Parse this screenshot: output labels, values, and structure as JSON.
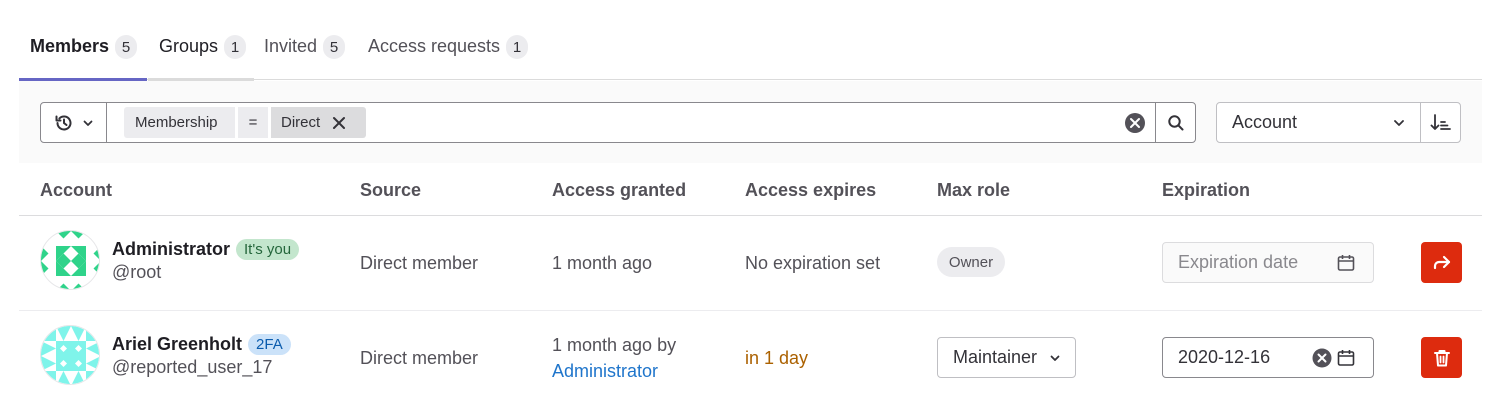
{
  "tabs": [
    {
      "label": "Members",
      "count": "5",
      "active": true
    },
    {
      "label": "Groups",
      "count": "1",
      "active": false
    },
    {
      "label": "Invited",
      "count": "5",
      "active": false
    },
    {
      "label": "Access requests",
      "count": "1",
      "active": false
    }
  ],
  "filter": {
    "token_key": "Membership",
    "token_operator": "=",
    "token_value": "Direct"
  },
  "sort": {
    "selected": "Account"
  },
  "table": {
    "headers": [
      "Account",
      "Source",
      "Access granted",
      "Access expires",
      "Max role",
      "Expiration"
    ],
    "rows": [
      {
        "name": "Administrator",
        "badge": "It's you",
        "username": "@root",
        "source": "Direct member",
        "access_granted": "1 month ago",
        "access_granted_by": "",
        "access_expires": "No expiration set",
        "max_role": "Owner",
        "expiration_value": "",
        "expiration_placeholder": "Expiration date",
        "action": "leave"
      },
      {
        "name": "Ariel Greenholt",
        "badge": "2FA",
        "username": "@reported_user_17",
        "source": "Direct member",
        "access_granted": "1 month ago by",
        "access_granted_by": "Administrator",
        "access_expires": "in 1 day",
        "max_role": "Maintainer",
        "expiration_value": "2020-12-16",
        "expiration_placeholder": "",
        "action": "remove"
      }
    ]
  },
  "colors": {
    "tab_active_underline": "#6666c4",
    "tab_inactive_underline": "#dbdbdb",
    "danger": "#dd2b0e",
    "link": "#1f75cb",
    "warning_text": "#ab6100",
    "avatar_green": "#2fd38a",
    "avatar_cyan": "#7ff4ea"
  }
}
